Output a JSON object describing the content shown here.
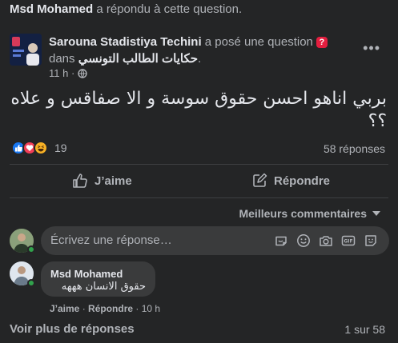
{
  "activity": {
    "actor": "Msd Mohamed",
    "text": "a répondu à cette question."
  },
  "post": {
    "author": "Sarouna Stadistiya Techini",
    "action_text": "a posé une question",
    "in_word": "dans",
    "group": "حكايات الطالب التونسي",
    "group_suffix": ".",
    "time": "11 h",
    "time_separator": "·",
    "text": "بربي اناهو احسن حقوق سوسة و الا صفاقس و علاه ؟؟",
    "reaction_count": "19",
    "answers_count": "58 réponses",
    "more_label": "•••"
  },
  "actions": {
    "like": "J’aime",
    "reply": "Répondre"
  },
  "comments_header": {
    "sort_label": "Meilleurs commentaires"
  },
  "composer": {
    "placeholder": "Écrivez une réponse…"
  },
  "comment": {
    "author": "Msd Mohamed",
    "text": "حقوق الانسان هههه",
    "like": "J’aime",
    "reply": "Répondre",
    "separator": "·",
    "time": "10 h"
  },
  "footer": {
    "see_more": "Voir plus de réponses",
    "pager": "1 sur 58"
  },
  "colors": {
    "background": "#242526",
    "bubble": "#3a3b3c",
    "like_blue": "#1877f2",
    "love_red": "#f33e58",
    "haha_yellow": "#f7b125",
    "question_badge": "#e41e3f",
    "online_green": "#31a24c"
  },
  "icons": {
    "reactions": [
      "like-reaction-icon",
      "love-reaction-icon",
      "haha-reaction-icon"
    ],
    "composer": [
      "sticker-icon",
      "emoji-icon",
      "camera-icon",
      "gif-icon",
      "avatar-sticker-icon"
    ]
  }
}
